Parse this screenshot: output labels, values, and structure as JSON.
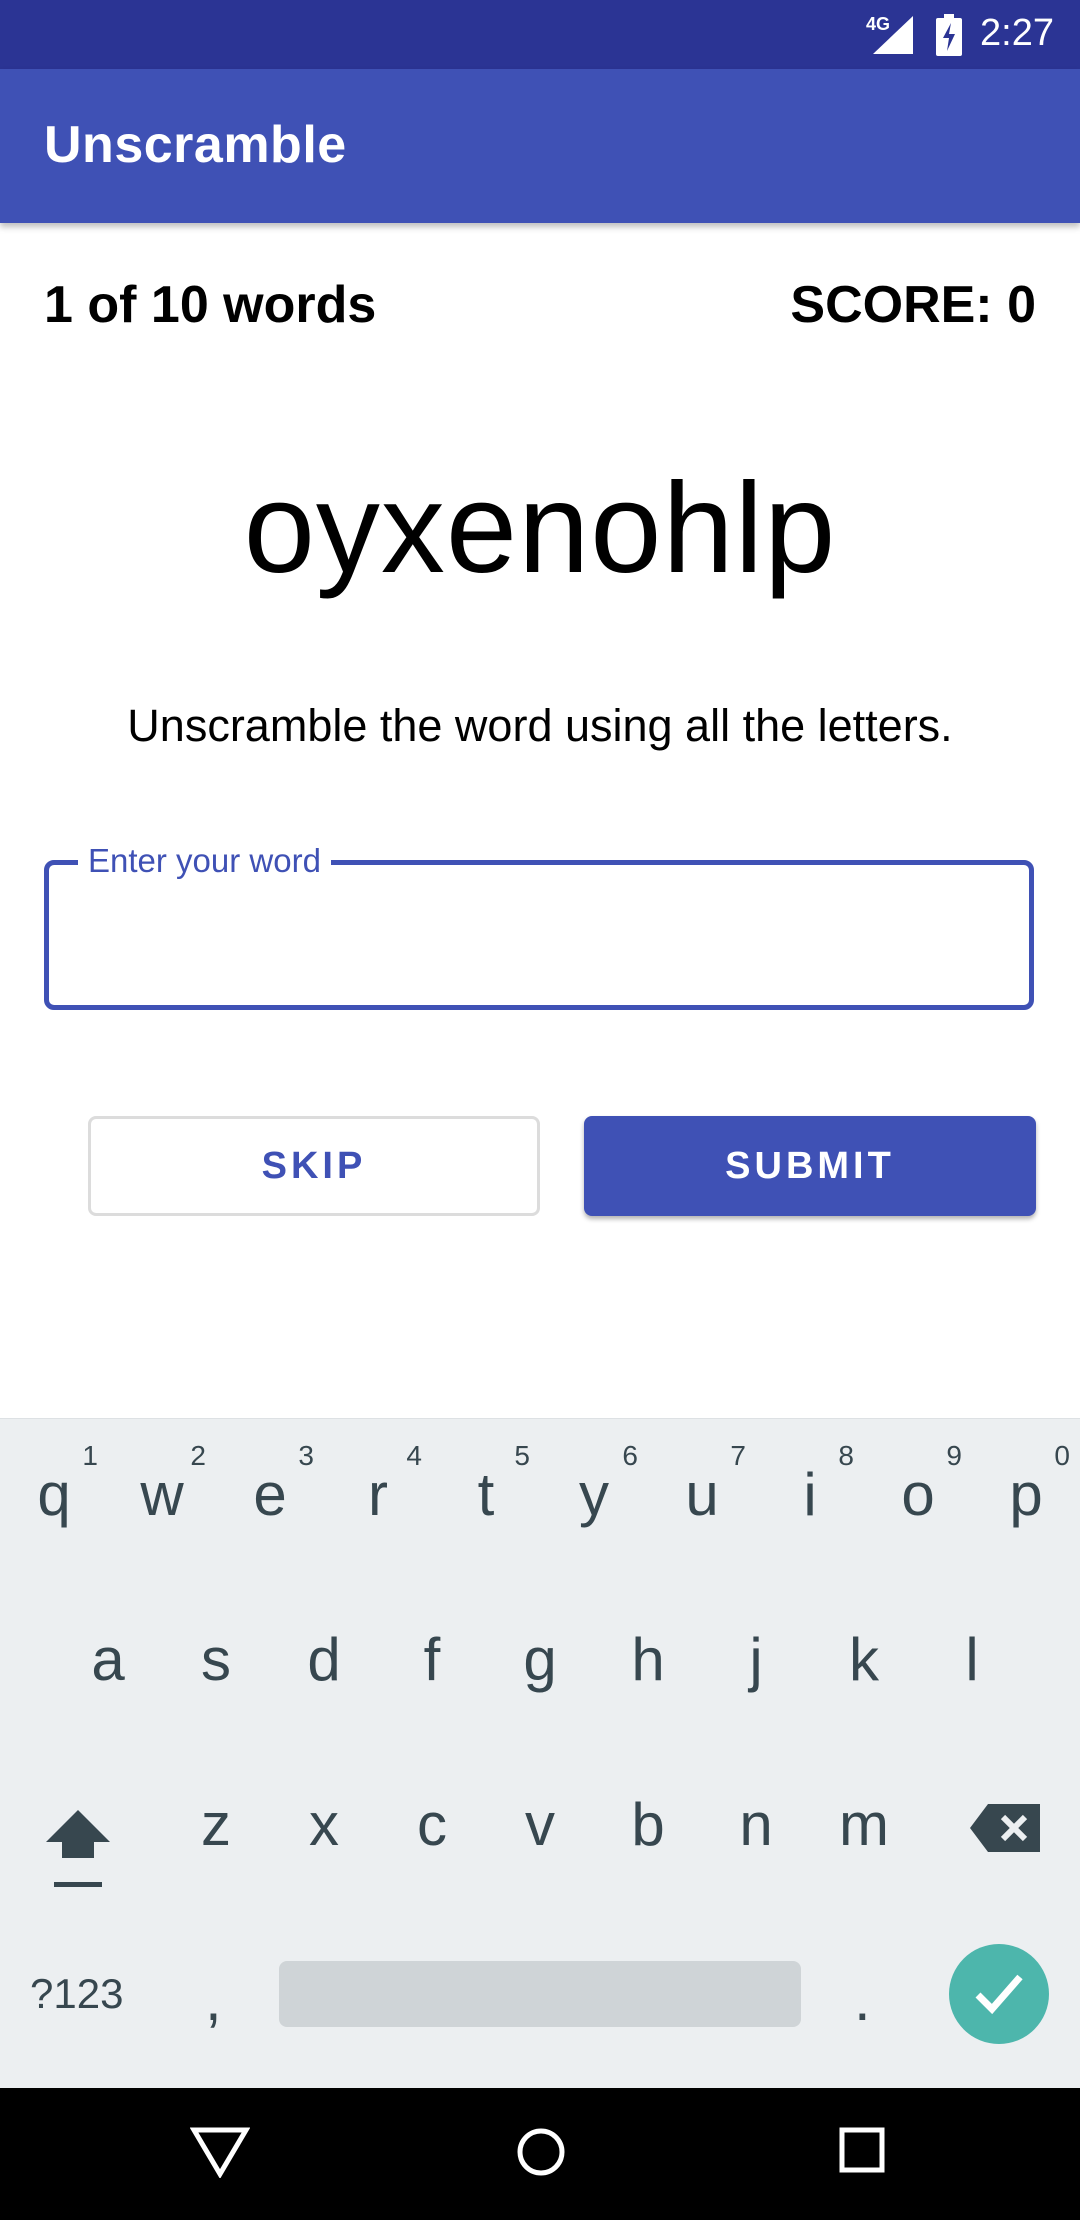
{
  "status_bar": {
    "network": "4G",
    "time": "2:27"
  },
  "app_bar": {
    "title": "Unscramble"
  },
  "game": {
    "progress": "1 of 10 words",
    "score": "SCORE: 0",
    "scrambled_word": "oyxenohlp",
    "instructions": "Unscramble the word using all the letters.",
    "input": {
      "label": "Enter your word",
      "value": ""
    },
    "skip_label": "SKIP",
    "submit_label": "SUBMIT"
  },
  "keyboard": {
    "row1": [
      {
        "key": "q",
        "hint": "1"
      },
      {
        "key": "w",
        "hint": "2"
      },
      {
        "key": "e",
        "hint": "3"
      },
      {
        "key": "r",
        "hint": "4"
      },
      {
        "key": "t",
        "hint": "5"
      },
      {
        "key": "y",
        "hint": "6"
      },
      {
        "key": "u",
        "hint": "7"
      },
      {
        "key": "i",
        "hint": "8"
      },
      {
        "key": "o",
        "hint": "9"
      },
      {
        "key": "p",
        "hint": "0"
      }
    ],
    "row2": [
      "a",
      "s",
      "d",
      "f",
      "g",
      "h",
      "j",
      "k",
      "l"
    ],
    "row3": [
      "z",
      "x",
      "c",
      "v",
      "b",
      "n",
      "m"
    ],
    "symbols_label": "?123",
    "comma": ",",
    "period": ".",
    "icons": {
      "shift": "shift-icon",
      "backspace": "backspace-icon",
      "done": "check-icon"
    },
    "accent_color": "#4db6ac"
  },
  "nav_bar": {
    "icons": [
      "back-icon",
      "home-icon",
      "recents-icon"
    ]
  },
  "colors": {
    "primary": "#3f51b5",
    "primary_dark": "#2b3494"
  }
}
